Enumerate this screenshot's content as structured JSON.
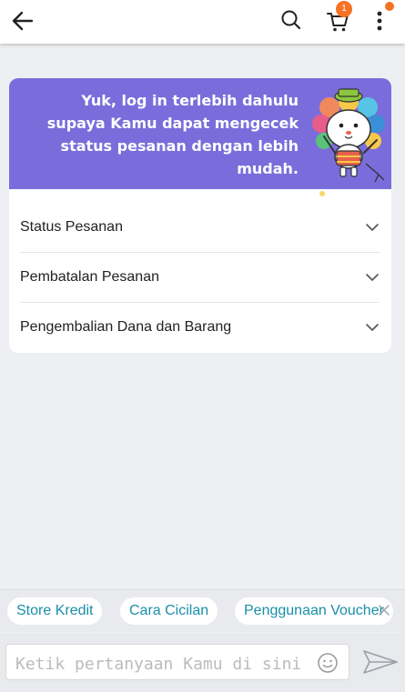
{
  "header": {
    "back_icon": "arrow-left-icon",
    "search_icon": "search-icon",
    "cart_icon": "cart-icon",
    "cart_count": "1",
    "more_icon": "more-vertical-icon",
    "accent": "#f57224"
  },
  "banner": {
    "lines": [
      "Yuk, log in terlebih dahulu",
      "supaya Kamu dapat mengecek",
      "status pesanan dengan lebih",
      "mudah."
    ],
    "background": "#7a6ddb",
    "mascot": "cat-mascot-drum-illustration"
  },
  "faq": {
    "items": [
      {
        "label": "Status Pesanan"
      },
      {
        "label": "Pembatalan Pesanan"
      },
      {
        "label": "Pengembalian Dana dan Barang"
      }
    ],
    "chevron_icon": "chevron-down-icon"
  },
  "quick_replies": {
    "chips": [
      {
        "label": "Store Kredit"
      },
      {
        "label": "Cara Cicilan"
      },
      {
        "label": "Penggunaan Voucher"
      }
    ],
    "close_icon": "close-icon",
    "chip_color": "#1a8fa8"
  },
  "composer": {
    "placeholder": "Ketik pertanyaan Kamu di sini",
    "emoji_icon": "smiley-icon",
    "send_icon": "send-icon"
  }
}
